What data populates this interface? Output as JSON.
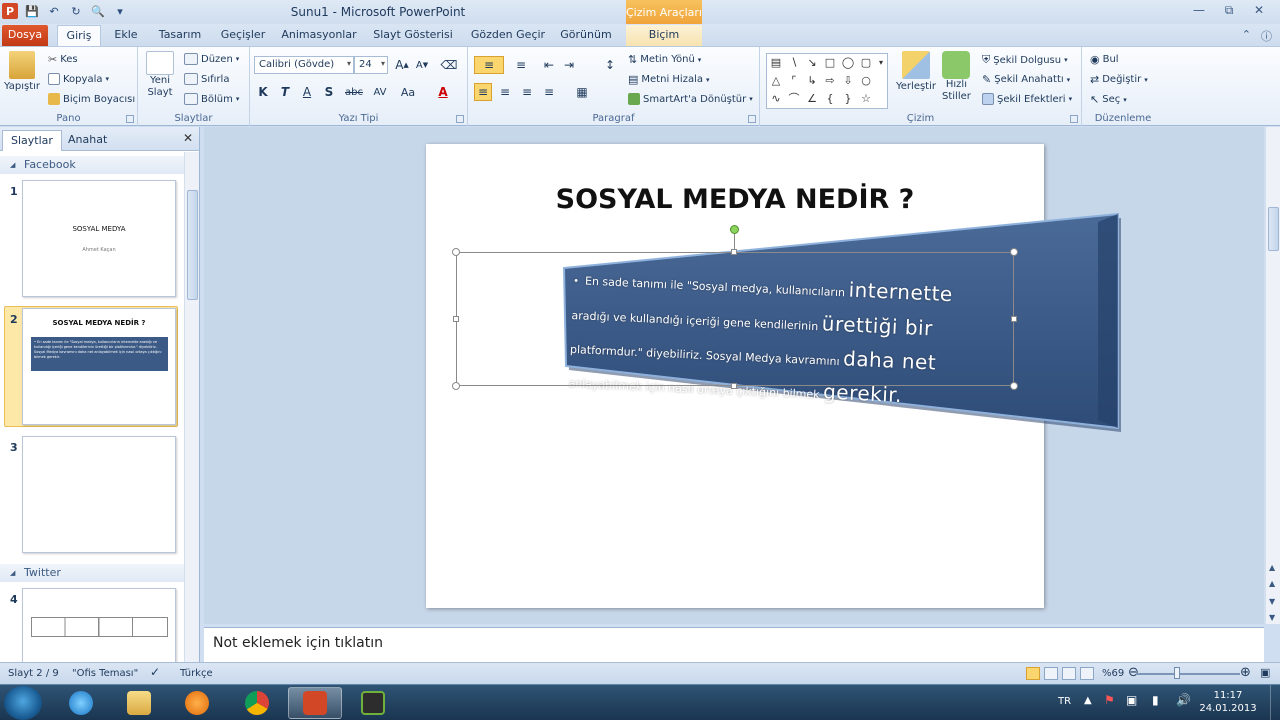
{
  "window": {
    "title": "Sunu1  -  Microsoft PowerPoint",
    "context_tab_header": "Çizim Araçları"
  },
  "tabs": [
    {
      "label": "Dosya"
    },
    {
      "label": "Giriş"
    },
    {
      "label": "Ekle"
    },
    {
      "label": "Tasarım"
    },
    {
      "label": "Geçişler"
    },
    {
      "label": "Animasyonlar"
    },
    {
      "label": "Slayt Gösterisi"
    },
    {
      "label": "Gözden Geçir"
    },
    {
      "label": "Görünüm"
    },
    {
      "label": "Biçim"
    }
  ],
  "ribbon": {
    "pano": {
      "label": "Pano",
      "paste": "Yapıştır",
      "cut": "Kes",
      "copy": "Kopyala",
      "format_painter": "Biçim Boyacısı"
    },
    "slaytlar": {
      "label": "Slaytlar",
      "new_slide_1": "Yeni",
      "new_slide_2": "Slayt",
      "layout": "Düzen",
      "reset": "Sıfırla",
      "section": "Bölüm"
    },
    "yazi_tipi": {
      "label": "Yazı Tipi",
      "font_name": "Calibri (Gövde)",
      "font_size": "24",
      "bold": "K",
      "italic": "T",
      "underline": "A",
      "shadow": "S",
      "strike": "abc",
      "spacing": "AV",
      "case": "Aa"
    },
    "paragraf": {
      "label": "Paragraf",
      "text_direction": "Metin Yönü",
      "align_text": "Metni Hizala",
      "smartart": "SmartArt'a Dönüştür"
    },
    "cizim": {
      "label": "Çizim",
      "arrange": "Yerleştir",
      "quick_styles_1": "Hızlı",
      "quick_styles_2": "Stiller",
      "shape_fill": "Şekil Dolgusu",
      "shape_outline": "Şekil Anahattı",
      "shape_effects": "Şekil Efektleri"
    },
    "duzenleme": {
      "label": "Düzenleme",
      "find": "Bul",
      "replace": "Değiştir",
      "select": "Seç"
    }
  },
  "left_pane": {
    "tabs": [
      "Slaytlar",
      "Anahat"
    ],
    "sections": [
      {
        "name": "Facebook"
      },
      {
        "name": "Twitter"
      }
    ],
    "slides": [
      {
        "num": "1",
        "title": "SOSYAL MEDYA",
        "subtitle": "Ahmet Kaçan"
      },
      {
        "num": "2",
        "title": "SOSYAL MEDYA NEDİR ?",
        "body": "• En sade tanımı ile \"Sosyal medya, kullanıcıların internette aradığı ve kullandığı içeriği gene kendilerinin ürettiği bir platformdur.\" diyebiliriz. Sosyal Medya kavramını daha net anlayabilmek için nasıl ortaya çıktığını bilmek gerekir."
      },
      {
        "num": "3"
      },
      {
        "num": "4"
      }
    ]
  },
  "slide": {
    "title": "SOSYAL MEDYA NEDİR ?",
    "body_lines": [
      {
        "small": "En sade tanımı ile \"Sosyal medya, kullanıcıların ",
        "big": "internette"
      },
      {
        "small": "aradığı ve kullandığı içeriği gene kendilerinin ",
        "big": "ürettiği bir"
      },
      {
        "small": "platformdur.\" diyebiliriz. Sosyal Medya kavramını ",
        "big": "daha net"
      },
      {
        "small": "anlayabilmek için nasıl ortaya çıktığını bilmek ",
        "big": "gerekir."
      }
    ],
    "banner_color": "#3b5a86"
  },
  "notes": {
    "placeholder": "Not eklemek için tıklatın"
  },
  "statusbar": {
    "slide_counter": "Slayt 2 / 9",
    "theme": "\"Ofis Teması\"",
    "language": "Türkçe",
    "zoom": "%69"
  },
  "taskbar": {
    "lang": "TR",
    "time": "11:17",
    "date": "24.01.2013"
  }
}
